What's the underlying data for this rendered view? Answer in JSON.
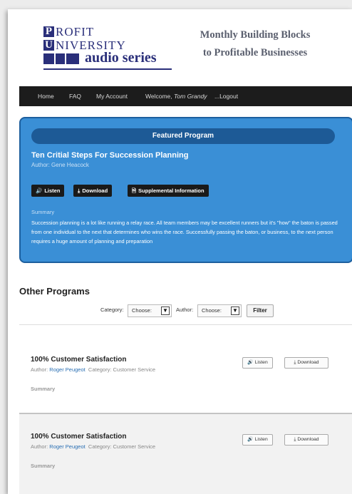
{
  "logo": {
    "line1_initial": "P",
    "line1_rest": "ROFIT",
    "line2_initial": "U",
    "line2_rest": "NIVERSITY",
    "line3": "audio series"
  },
  "tagline": {
    "line1": "Monthly Building Blocks",
    "line2": "to Profitable Businesses"
  },
  "nav": {
    "home": "Home",
    "faq": "FAQ",
    "account": "My Account",
    "welcome": "Welcome,",
    "user": "Tom Grandy",
    "logout": "...Logout"
  },
  "featured": {
    "header": "Featured Program",
    "title": "Ten Critial Steps For Succession Planning",
    "author": "Author: Gene Heacock",
    "listen": "Listen",
    "download": "Download",
    "supplemental": "Supplemental Information",
    "summary_label": "Summary",
    "summary": "Succession planning is a lot like running a relay race. All team members may be excellent runners but it's \"how\" the baton is passed from one individual to the next that determines who wins the race. Successfully passing the baton, or business, to the next person requires a huge amount of planning and preparation"
  },
  "other": {
    "title": "Other Programs",
    "category_label": "Category:",
    "category_value": "Choose:",
    "author_label": "Author:",
    "author_value": "Choose:",
    "filter_label": "Filter"
  },
  "programs": [
    {
      "title": "100% Customer Satisfaction",
      "author_label": "Author:",
      "author": "Roger Peugeot",
      "category": "Category: Customer Service",
      "summary_label": "Summary",
      "listen": "Listen",
      "download": "Download"
    },
    {
      "title": "100% Customer Satisfaction",
      "author_label": "Author:",
      "author": "Roger Peugeot",
      "category": "Category: Customer Service",
      "summary_label": "Summary",
      "listen": "Listen",
      "download": "Download"
    }
  ],
  "icons": {
    "listen": "speaker-icon",
    "download": "download-icon",
    "supplemental": "document-icon",
    "select_arrow": "chevron-down-icon"
  },
  "colors": {
    "brand": "#2a2f7a",
    "featured_bg": "#3a8fd6",
    "featured_header": "#1d5a96",
    "nav_bg": "#1c1c1c",
    "author_link": "#2a6fb3"
  }
}
